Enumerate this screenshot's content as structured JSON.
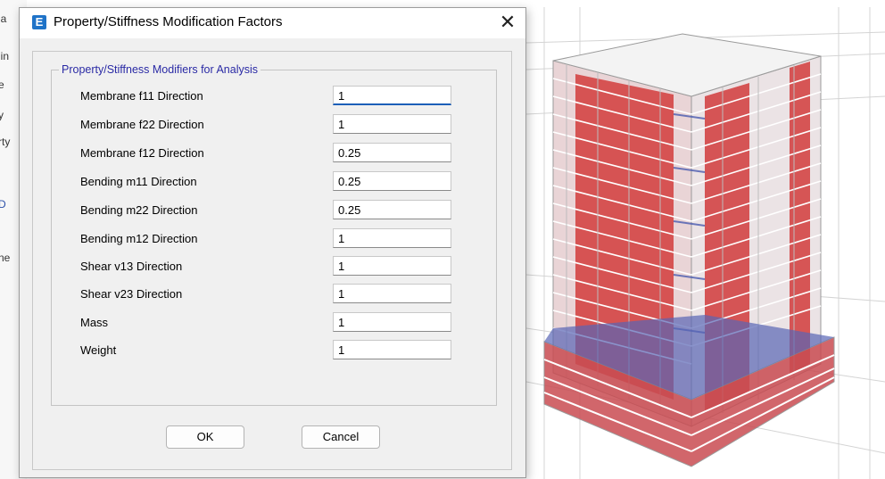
{
  "dialog": {
    "title": "Property/Stiffness Modification Factors",
    "close_glyph": "✕",
    "group_title": "Property/Stiffness Modifiers for Analysis",
    "rows": [
      {
        "label": "Membrane f11 Direction",
        "value": "1"
      },
      {
        "label": "Membrane f22 Direction",
        "value": "1"
      },
      {
        "label": "Membrane f12 Direction",
        "value": "0.25"
      },
      {
        "label": "Bending m11 Direction",
        "value": "0.25"
      },
      {
        "label": "Bending m22 Direction",
        "value": "0.25"
      },
      {
        "label": "Bending m12 Direction",
        "value": "1"
      },
      {
        "label": "Shear v13 Direction",
        "value": "1"
      },
      {
        "label": "Shear v23 Direction",
        "value": "1"
      },
      {
        "label": "Mass",
        "value": "1"
      },
      {
        "label": "Weight",
        "value": "1"
      }
    ],
    "ok_label": "OK",
    "cancel_label": "Cancel"
  },
  "background_fragments": [
    "ia",
    "lin",
    "e",
    "y",
    "rty",
    "D",
    "ne"
  ],
  "colors": {
    "accent_blue": "#1f73c8",
    "group_title": "#2a2aa5",
    "wall_red": "#d23c3c",
    "slab_blue": "#4a5cb0"
  },
  "icons": {
    "app": "etabs-app-icon",
    "close": "close-icon"
  }
}
